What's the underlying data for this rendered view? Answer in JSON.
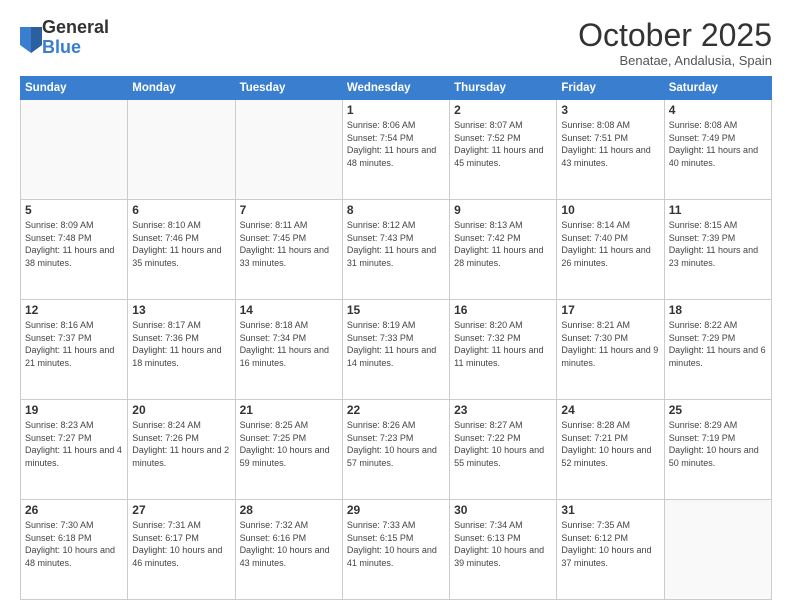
{
  "header": {
    "logo_general": "General",
    "logo_blue": "Blue",
    "month": "October 2025",
    "location": "Benatae, Andalusia, Spain"
  },
  "weekdays": [
    "Sunday",
    "Monday",
    "Tuesday",
    "Wednesday",
    "Thursday",
    "Friday",
    "Saturday"
  ],
  "weeks": [
    [
      {
        "day": "",
        "info": ""
      },
      {
        "day": "",
        "info": ""
      },
      {
        "day": "",
        "info": ""
      },
      {
        "day": "1",
        "info": "Sunrise: 8:06 AM\nSunset: 7:54 PM\nDaylight: 11 hours\nand 48 minutes."
      },
      {
        "day": "2",
        "info": "Sunrise: 8:07 AM\nSunset: 7:52 PM\nDaylight: 11 hours\nand 45 minutes."
      },
      {
        "day": "3",
        "info": "Sunrise: 8:08 AM\nSunset: 7:51 PM\nDaylight: 11 hours\nand 43 minutes."
      },
      {
        "day": "4",
        "info": "Sunrise: 8:08 AM\nSunset: 7:49 PM\nDaylight: 11 hours\nand 40 minutes."
      }
    ],
    [
      {
        "day": "5",
        "info": "Sunrise: 8:09 AM\nSunset: 7:48 PM\nDaylight: 11 hours\nand 38 minutes."
      },
      {
        "day": "6",
        "info": "Sunrise: 8:10 AM\nSunset: 7:46 PM\nDaylight: 11 hours\nand 35 minutes."
      },
      {
        "day": "7",
        "info": "Sunrise: 8:11 AM\nSunset: 7:45 PM\nDaylight: 11 hours\nand 33 minutes."
      },
      {
        "day": "8",
        "info": "Sunrise: 8:12 AM\nSunset: 7:43 PM\nDaylight: 11 hours\nand 31 minutes."
      },
      {
        "day": "9",
        "info": "Sunrise: 8:13 AM\nSunset: 7:42 PM\nDaylight: 11 hours\nand 28 minutes."
      },
      {
        "day": "10",
        "info": "Sunrise: 8:14 AM\nSunset: 7:40 PM\nDaylight: 11 hours\nand 26 minutes."
      },
      {
        "day": "11",
        "info": "Sunrise: 8:15 AM\nSunset: 7:39 PM\nDaylight: 11 hours\nand 23 minutes."
      }
    ],
    [
      {
        "day": "12",
        "info": "Sunrise: 8:16 AM\nSunset: 7:37 PM\nDaylight: 11 hours\nand 21 minutes."
      },
      {
        "day": "13",
        "info": "Sunrise: 8:17 AM\nSunset: 7:36 PM\nDaylight: 11 hours\nand 18 minutes."
      },
      {
        "day": "14",
        "info": "Sunrise: 8:18 AM\nSunset: 7:34 PM\nDaylight: 11 hours\nand 16 minutes."
      },
      {
        "day": "15",
        "info": "Sunrise: 8:19 AM\nSunset: 7:33 PM\nDaylight: 11 hours\nand 14 minutes."
      },
      {
        "day": "16",
        "info": "Sunrise: 8:20 AM\nSunset: 7:32 PM\nDaylight: 11 hours\nand 11 minutes."
      },
      {
        "day": "17",
        "info": "Sunrise: 8:21 AM\nSunset: 7:30 PM\nDaylight: 11 hours\nand 9 minutes."
      },
      {
        "day": "18",
        "info": "Sunrise: 8:22 AM\nSunset: 7:29 PM\nDaylight: 11 hours\nand 6 minutes."
      }
    ],
    [
      {
        "day": "19",
        "info": "Sunrise: 8:23 AM\nSunset: 7:27 PM\nDaylight: 11 hours\nand 4 minutes."
      },
      {
        "day": "20",
        "info": "Sunrise: 8:24 AM\nSunset: 7:26 PM\nDaylight: 11 hours\nand 2 minutes."
      },
      {
        "day": "21",
        "info": "Sunrise: 8:25 AM\nSunset: 7:25 PM\nDaylight: 10 hours\nand 59 minutes."
      },
      {
        "day": "22",
        "info": "Sunrise: 8:26 AM\nSunset: 7:23 PM\nDaylight: 10 hours\nand 57 minutes."
      },
      {
        "day": "23",
        "info": "Sunrise: 8:27 AM\nSunset: 7:22 PM\nDaylight: 10 hours\nand 55 minutes."
      },
      {
        "day": "24",
        "info": "Sunrise: 8:28 AM\nSunset: 7:21 PM\nDaylight: 10 hours\nand 52 minutes."
      },
      {
        "day": "25",
        "info": "Sunrise: 8:29 AM\nSunset: 7:19 PM\nDaylight: 10 hours\nand 50 minutes."
      }
    ],
    [
      {
        "day": "26",
        "info": "Sunrise: 7:30 AM\nSunset: 6:18 PM\nDaylight: 10 hours\nand 48 minutes."
      },
      {
        "day": "27",
        "info": "Sunrise: 7:31 AM\nSunset: 6:17 PM\nDaylight: 10 hours\nand 46 minutes."
      },
      {
        "day": "28",
        "info": "Sunrise: 7:32 AM\nSunset: 6:16 PM\nDaylight: 10 hours\nand 43 minutes."
      },
      {
        "day": "29",
        "info": "Sunrise: 7:33 AM\nSunset: 6:15 PM\nDaylight: 10 hours\nand 41 minutes."
      },
      {
        "day": "30",
        "info": "Sunrise: 7:34 AM\nSunset: 6:13 PM\nDaylight: 10 hours\nand 39 minutes."
      },
      {
        "day": "31",
        "info": "Sunrise: 7:35 AM\nSunset: 6:12 PM\nDaylight: 10 hours\nand 37 minutes."
      },
      {
        "day": "",
        "info": ""
      }
    ]
  ]
}
